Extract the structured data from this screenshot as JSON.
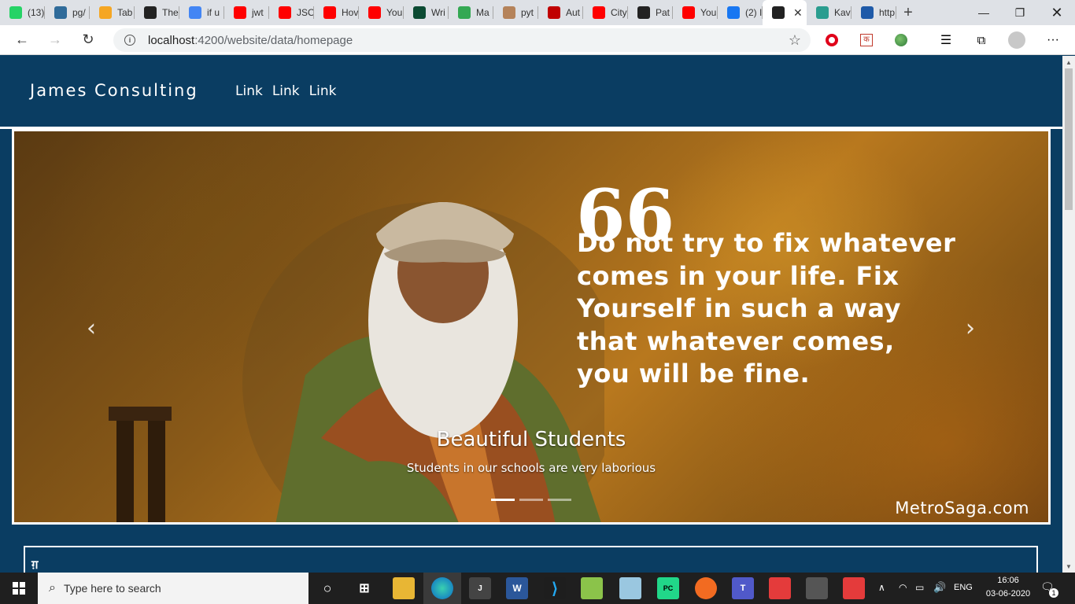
{
  "browser": {
    "tabs": [
      {
        "label": "(13)",
        "icon": "whatsapp-icon",
        "color": "#25d366"
      },
      {
        "label": "pg/",
        "icon": "pg-icon",
        "color": "#2f6b9a"
      },
      {
        "label": "Tab",
        "icon": "shield-icon",
        "color": "#f5a623"
      },
      {
        "label": "The",
        "icon": "wix-icon",
        "color": "#222222"
      },
      {
        "label": "if u",
        "icon": "google-icon",
        "color": "#4285f4"
      },
      {
        "label": "jwt",
        "icon": "youtube-icon",
        "color": "#ff0000"
      },
      {
        "label": "JSO",
        "icon": "youtube-icon",
        "color": "#ff0000"
      },
      {
        "label": "Hov",
        "icon": "youtube-icon",
        "color": "#ff0000"
      },
      {
        "label": "You",
        "icon": "youtube-icon",
        "color": "#ff0000"
      },
      {
        "label": "Wri",
        "icon": "django-icon",
        "color": "#0c4b33"
      },
      {
        "label": "Ma",
        "icon": "spinner-icon",
        "color": "#34a853"
      },
      {
        "label": "pyt",
        "icon": "python-icon",
        "color": "#b5835a"
      },
      {
        "label": "Aut",
        "icon": "dots-icon",
        "color": "#c00000"
      },
      {
        "label": "City",
        "icon": "youtube-icon",
        "color": "#ff0000"
      },
      {
        "label": "Pat",
        "icon": "angular-icon",
        "color": "#222222"
      },
      {
        "label": "You",
        "icon": "youtube-icon",
        "color": "#ff0000"
      },
      {
        "label": "(2) I",
        "icon": "facebook-icon",
        "color": "#1877f2"
      },
      {
        "label": "",
        "icon": "angular-icon",
        "color": "#222222",
        "active": true
      },
      {
        "label": "Kav",
        "icon": "bookmark-icon",
        "color": "#2a9d8f"
      },
      {
        "label": "http",
        "icon": "cube-icon",
        "color": "#1e5aa8"
      }
    ],
    "url_host": "localhost",
    "url_path": ":4200/website/data/homepage"
  },
  "site": {
    "brand": "James Consulting",
    "nav_links": [
      "Link",
      "Link",
      "Link"
    ]
  },
  "carousel": {
    "quote_mark": "66",
    "quote_lines": [
      "Do not try to fix whatever",
      "comes in your life. Fix",
      "Yourself in such a way",
      "that whatever comes,",
      "you will be fine."
    ],
    "watermark": "MetroSaga.com",
    "caption_title": "Beautiful Students",
    "caption_text": "Students in our schools are very laborious",
    "indicators": [
      true,
      false,
      false
    ],
    "prev_label": "‹",
    "next_label": "›"
  },
  "content_card": {
    "text": "ग़"
  },
  "taskbar": {
    "search_placeholder": "Type here to search",
    "time": "16:06",
    "date": "03-06-2020",
    "language": "ENG",
    "notification_count": "1"
  }
}
